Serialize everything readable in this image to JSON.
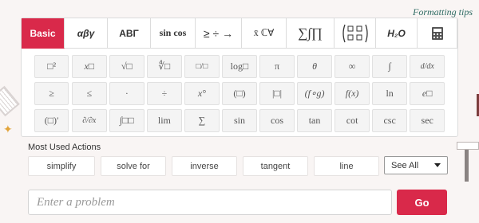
{
  "header": {
    "formatting_tips": "Formatting tips"
  },
  "tabs": [
    {
      "id": "basic",
      "label": "Basic",
      "active": true
    },
    {
      "id": "greek-lower",
      "label": "αβγ"
    },
    {
      "id": "greek-upper",
      "label": "ΑΒΓ"
    },
    {
      "id": "trig",
      "label": "sin cos"
    },
    {
      "id": "operators",
      "label": "≥ ÷ →"
    },
    {
      "id": "sets",
      "label": "x̄ ℂ∀"
    },
    {
      "id": "calculus",
      "label": "∑∫∏"
    },
    {
      "id": "matrix",
      "label": "matrix"
    },
    {
      "id": "chemistry",
      "label": "H₂O"
    },
    {
      "id": "calculator",
      "label": "calculator"
    }
  ],
  "keypad": {
    "row1": [
      "□²",
      "x□",
      "√□",
      "∜□",
      "□/□",
      "log□",
      "π",
      "θ",
      "∞",
      "∫",
      "d/dx"
    ],
    "row2": [
      "≥",
      "≤",
      "·",
      "÷",
      "x°",
      "(□)",
      "|□|",
      "(f∘g)",
      "f(x)",
      "ln",
      "e□"
    ],
    "row3": [
      "(□)′",
      "∂/∂x",
      "∫□□",
      "lim",
      "∑",
      "sin",
      "cos",
      "tan",
      "cot",
      "csc",
      "sec"
    ]
  },
  "most_used": {
    "title": "Most Used Actions",
    "actions": [
      "simplify",
      "solve for",
      "inverse",
      "tangent",
      "line"
    ],
    "see_all": "See All"
  },
  "problem": {
    "placeholder": "Enter a problem",
    "value": ""
  },
  "go_label": "Go",
  "colors": {
    "accent": "#d9294a",
    "tips": "#2f6b63"
  }
}
